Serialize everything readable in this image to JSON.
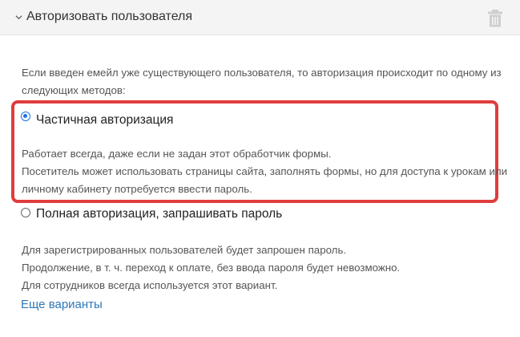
{
  "header": {
    "title": "Авторизовать пользователя"
  },
  "intro_lines": [
    "Если введен емейл уже существующего пользователя, то авторизация происходит по одному из",
    "следующих методов:"
  ],
  "options": [
    {
      "label": "Частичная авторизация",
      "checked": true,
      "description": [
        "Работает всегда, даже если не задан этот обработчик формы.",
        "Посетитель может использовать страницы сайта, заполнять формы, но для доступа к урокам или",
        "личному кабинету потребуется ввести пароль."
      ]
    },
    {
      "label": "Полная авторизация, запрашивать пароль",
      "checked": false,
      "description": [
        "Для зарегистрированных пользователей будет запрошен пароль.",
        "Продолжение, в т. ч. переход к оплате, без ввода пароля будет невозможно.",
        "Для сотрудников всегда используется этот вариант."
      ]
    }
  ],
  "more_link": "Еще варианты",
  "colors": {
    "accent": "#1a73e8",
    "link": "#2e78b7",
    "highlight_border": "#e03c3c"
  }
}
